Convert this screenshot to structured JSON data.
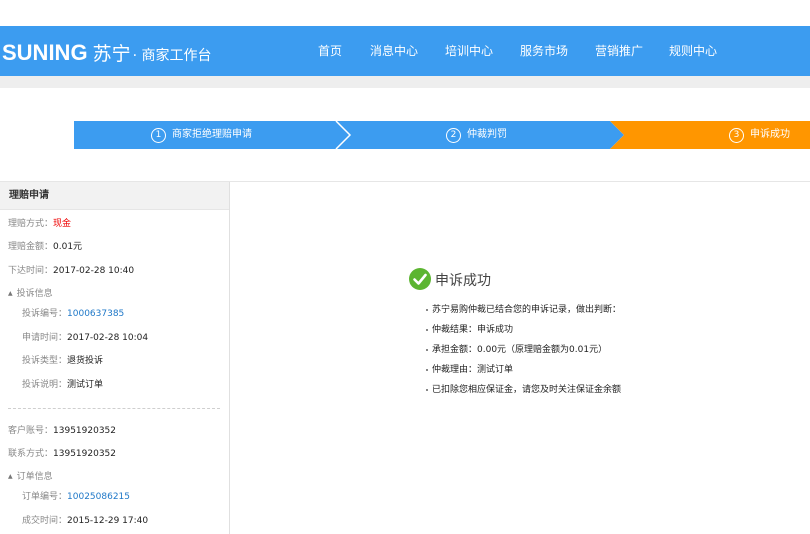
{
  "header": {
    "logo_brand": "SUNING",
    "logo_cn": "苏宁",
    "logo_sub": "· 商家工作台",
    "nav": [
      "首页",
      "消息中心",
      "培训中心",
      "服务市场",
      "营销推广",
      "规则中心"
    ]
  },
  "steps": [
    {
      "num": "1",
      "label": "商家拒绝理赔申请",
      "color": "#3c9cf0"
    },
    {
      "num": "2",
      "label": "仲裁判罚",
      "color": "#3c9cf0"
    },
    {
      "num": "3",
      "label": "申诉成功",
      "color": "#ff9600"
    }
  ],
  "sidebar": {
    "title": "理赔申请",
    "claim_method_label": "理赔方式：",
    "claim_method_value": "现金",
    "claim_amount_label": "理赔金额：",
    "claim_amount_value": "0.01元",
    "order_time_label": "下达时间：",
    "order_time_value": "2017-02-28 10:40",
    "complaint_group": "投诉信息",
    "complaint_no_label": "投诉编号：",
    "complaint_no_value": "1000637385",
    "apply_time_label": "申请时间：",
    "apply_time_value": "2017-02-28 10:04",
    "complaint_type_label": "投诉类型：",
    "complaint_type_value": "退货投诉",
    "complaint_desc_label": "投诉说明：",
    "complaint_desc_value": "测试订单",
    "customer_acct_label": "客户账号：",
    "customer_acct_value": "13951920352",
    "contact_label": "联系方式：",
    "contact_value": "13951920352",
    "order_group": "订单信息",
    "order_no_label": "订单编号：",
    "order_no_value": "10025086215",
    "deal_time_label": "成交时间：",
    "deal_time_value": "2015-12-29 17:40"
  },
  "result": {
    "title": "申诉成功",
    "lines": [
      "苏宁易购仲裁已结合您的申诉记录，做出判断：",
      "仲裁结果：申诉成功",
      "承担金额：0.00元（原理赔金额为0.01元）",
      "仲裁理由：测试订单",
      "已扣除您相应保证金，请您及时关注保证金余额"
    ]
  },
  "colors": {
    "header_blue": "#3c9cf0",
    "step_active": "#ff9600",
    "success_green": "#5cb531",
    "highlight_red": "#e00000",
    "link_blue": "#1f78c8"
  }
}
